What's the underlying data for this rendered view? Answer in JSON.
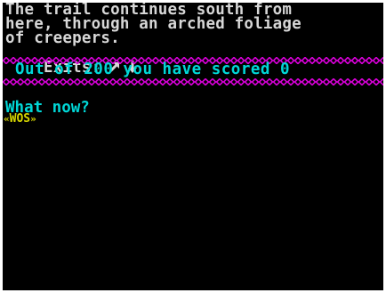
{
  "text": {
    "line1": "The trail continues south from",
    "line2": "here, through an arched foliage",
    "line3": "of creepers.",
    "exits_label": "Exits:",
    "exit_directions": [
      "north-east",
      "south"
    ]
  },
  "status": {
    "score_text": "Out of 200 you have scored 0"
  },
  "input": {
    "prompt": "What now?",
    "logo_text": "WOS",
    "logo_left": "«",
    "logo_right": "»"
  },
  "colors": {
    "background": "#000000",
    "narrative": "#d7d7d7",
    "score": "#00d7d7",
    "border": "#d700d7",
    "prompt": "#00d7d7",
    "logo": "#d7d700"
  }
}
